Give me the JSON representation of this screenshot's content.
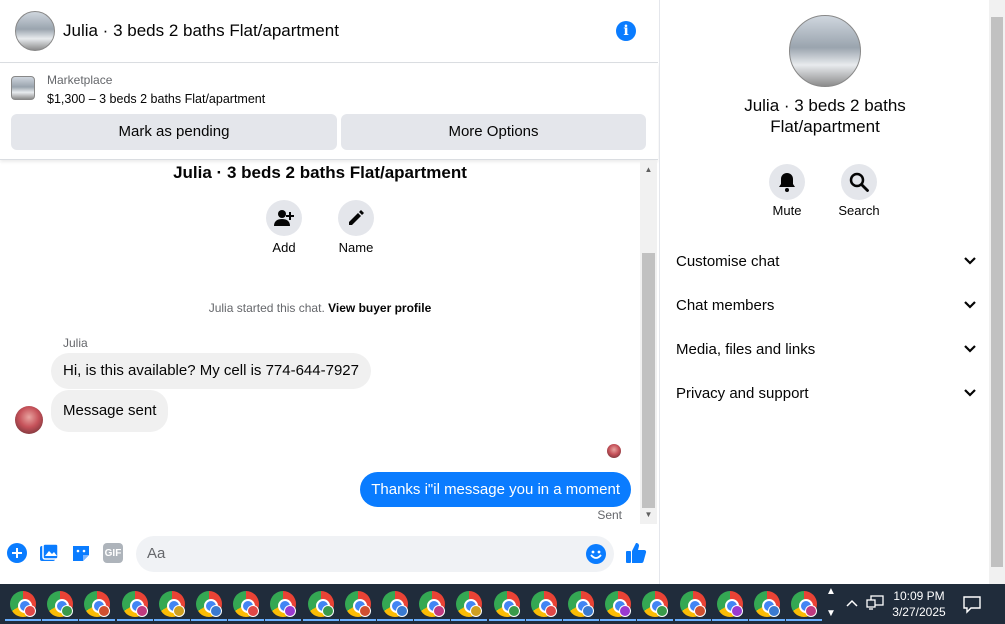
{
  "header": {
    "title": "Julia · 3 beds 2 baths Flat/apartment"
  },
  "marketplace": {
    "label": "Marketplace",
    "price_line": "$1,300 – 3 beds 2 baths Flat/apartment",
    "mark_pending": "Mark as pending",
    "more_options": "More Options"
  },
  "chat": {
    "group_title": "Julia · 3 beds 2 baths Flat/apartment",
    "actions": [
      {
        "label": "Add",
        "icon": "add-person-icon"
      },
      {
        "label": "Name",
        "icon": "pencil-icon"
      }
    ],
    "started_text": "Julia started this chat.",
    "view_profile": "View buyer profile",
    "sender_name": "Julia",
    "incoming": [
      "Hi, is this available? My cell is 774-644-7927",
      "Message sent"
    ],
    "outgoing": "Thanks i\"il message you in a moment",
    "status": "Sent"
  },
  "composer": {
    "placeholder": "Aa",
    "gif_label": "GIF"
  },
  "details": {
    "name": "Julia · 3 beds 2 baths Flat/apartment",
    "actions": [
      {
        "label": "Mute",
        "icon": "bell-icon"
      },
      {
        "label": "Search",
        "icon": "search-icon"
      }
    ],
    "sections": [
      "Customise chat",
      "Chat members",
      "Media, files and links",
      "Privacy and support"
    ]
  },
  "taskbar": {
    "time": "10:09 PM",
    "date": "3/27/2025"
  },
  "colors": {
    "accent": "#0a7cff",
    "bubble_in": "#f0f0f0",
    "taskbar": "#202c3b"
  }
}
